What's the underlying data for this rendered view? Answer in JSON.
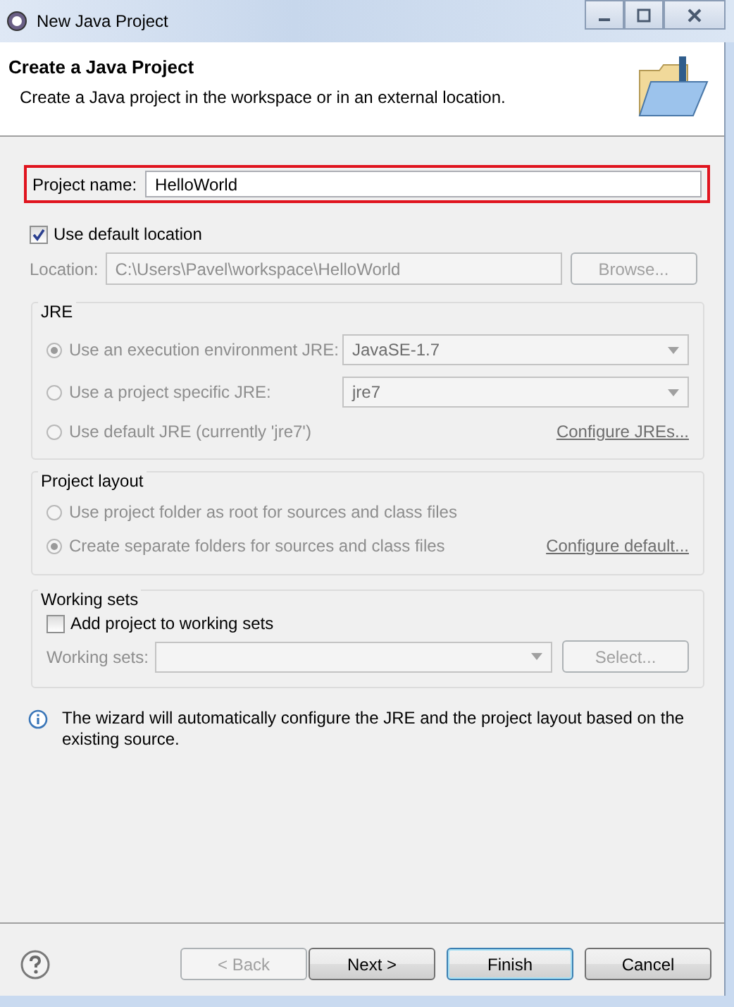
{
  "window": {
    "title": "New Java Project"
  },
  "header": {
    "title": "Create a Java Project",
    "description": "Create a Java project in the workspace or in an external location."
  },
  "project_name": {
    "label": "Project name:",
    "value": "HelloWorld",
    "highlighted": true
  },
  "use_default_location": {
    "label": "Use default location",
    "checked": true
  },
  "location": {
    "label": "Location:",
    "value": "C:\\Users\\Pavel\\workspace\\HelloWorld",
    "disabled": true,
    "button": "Browse..."
  },
  "jre": {
    "title": "JRE",
    "options": [
      {
        "kind": "combo",
        "label": "Use an execution environment JRE:",
        "selected": true,
        "disabled": true,
        "value": "JavaSE-1.7"
      },
      {
        "kind": "combo",
        "label": "Use a project specific JRE:",
        "selected": false,
        "disabled": true,
        "value": "jre7"
      },
      {
        "kind": "link",
        "label": "Use default JRE (currently 'jre7')",
        "selected": false,
        "disabled": true,
        "link": "Configure JREs..."
      }
    ]
  },
  "project_layout": {
    "title": "Project layout",
    "options": [
      {
        "kind": "plain",
        "label": "Use project folder as root for sources and class files",
        "selected": false,
        "disabled": true
      },
      {
        "kind": "link",
        "label": "Create separate folders for sources and class files",
        "selected": true,
        "disabled": true,
        "link": "Configure default..."
      }
    ]
  },
  "working_sets": {
    "title": "Working sets",
    "checkbox": {
      "label": "Add project to working sets",
      "checked": false
    },
    "field_label": "Working sets:",
    "disabled": true,
    "button": "Select..."
  },
  "info": "The wizard will automatically configure the JRE and the project layout based on the existing source.",
  "buttons": [
    {
      "label": "< Back",
      "disabled": true,
      "default": false
    },
    {
      "label": "Next >",
      "disabled": false,
      "default": false
    },
    {
      "label": "Finish",
      "disabled": false,
      "default": true
    },
    {
      "label": "Cancel",
      "disabled": false,
      "default": false
    }
  ]
}
